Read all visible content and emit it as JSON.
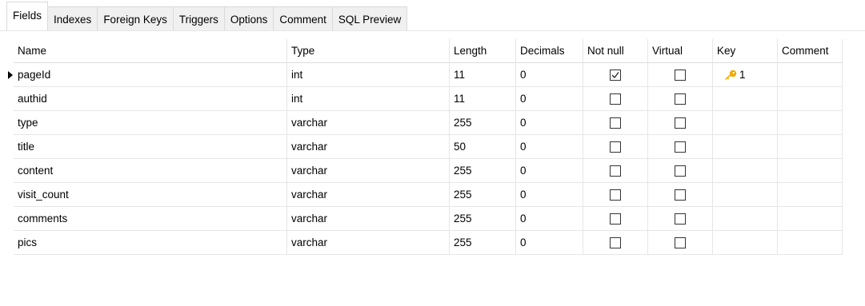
{
  "tabs": [
    "Fields",
    "Indexes",
    "Foreign Keys",
    "Triggers",
    "Options",
    "Comment",
    "SQL Preview"
  ],
  "active_tab": "Fields",
  "columns": {
    "name": "Name",
    "type": "Type",
    "length": "Length",
    "decimals": "Decimals",
    "not_null": "Not null",
    "virtual": "Virtual",
    "key": "Key",
    "comment": "Comment"
  },
  "rows": [
    {
      "name": "pageId",
      "type": "int",
      "length": "11",
      "decimals": "0",
      "not_null": true,
      "virtual": false,
      "key": "1",
      "comment": ""
    },
    {
      "name": "authid",
      "type": "int",
      "length": "11",
      "decimals": "0",
      "not_null": false,
      "virtual": false,
      "key": "",
      "comment": ""
    },
    {
      "name": "type",
      "type": "varchar",
      "length": "255",
      "decimals": "0",
      "not_null": false,
      "virtual": false,
      "key": "",
      "comment": ""
    },
    {
      "name": "title",
      "type": "varchar",
      "length": "50",
      "decimals": "0",
      "not_null": false,
      "virtual": false,
      "key": "",
      "comment": ""
    },
    {
      "name": "content",
      "type": "varchar",
      "length": "255",
      "decimals": "0",
      "not_null": false,
      "virtual": false,
      "key": "",
      "comment": ""
    },
    {
      "name": "visit_count",
      "type": "varchar",
      "length": "255",
      "decimals": "0",
      "not_null": false,
      "virtual": false,
      "key": "",
      "comment": ""
    },
    {
      "name": "comments",
      "type": "varchar",
      "length": "255",
      "decimals": "0",
      "not_null": false,
      "virtual": false,
      "key": "",
      "comment": ""
    },
    {
      "name": "pics",
      "type": "varchar",
      "length": "255",
      "decimals": "0",
      "not_null": false,
      "virtual": false,
      "key": "",
      "comment": ""
    }
  ],
  "current_row": 0,
  "colors": {
    "key_icon": "#f2a900",
    "grid_line": "#e6e6e6"
  }
}
